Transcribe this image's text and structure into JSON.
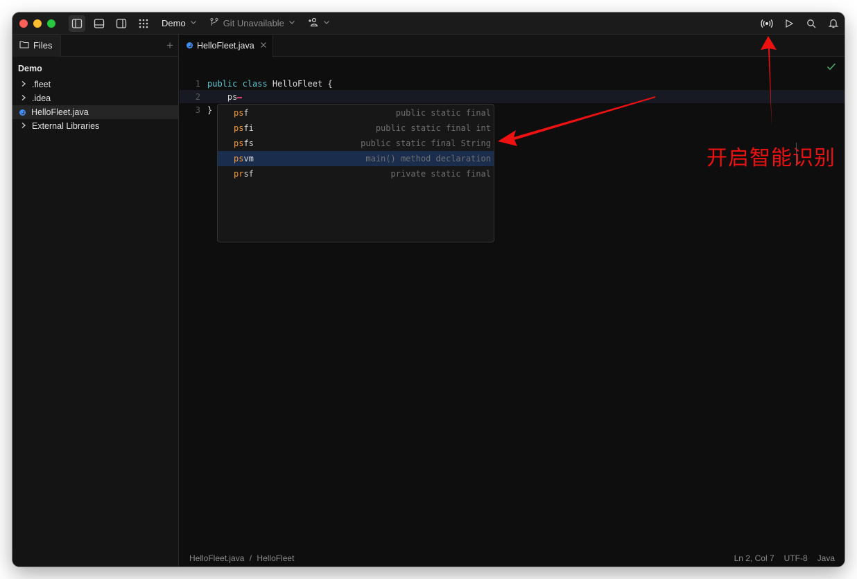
{
  "titlebar": {
    "project_label": "Demo",
    "git_label": "Git Unavailable"
  },
  "sidebar": {
    "tab_label": "Files",
    "project_title": "Demo",
    "items": [
      {
        "label": ".fleet",
        "type": "folder"
      },
      {
        "label": ".idea",
        "type": "folder"
      },
      {
        "label": "HelloFleet.java",
        "type": "java-file",
        "selected": true
      },
      {
        "label": "External Libraries",
        "type": "folder"
      }
    ]
  },
  "editor": {
    "tab_label": "HelloFleet.java",
    "lines": [
      {
        "number": "1",
        "keywords": "public class",
        "text": " HelloFleet {"
      },
      {
        "number": "2",
        "text": "    ps"
      },
      {
        "number": "3",
        "text": "}"
      }
    ]
  },
  "completion": {
    "items": [
      {
        "match": "ps",
        "rest": "f",
        "desc": "public static final"
      },
      {
        "match": "ps",
        "rest": "fi",
        "desc": "public static final int"
      },
      {
        "match": "ps",
        "rest": "fs",
        "desc": "public static final String"
      },
      {
        "match": "ps",
        "rest": "vm",
        "desc": "main() method declaration",
        "selected": true
      },
      {
        "match": "pr",
        "rest": "sf",
        "desc": "private static final"
      }
    ]
  },
  "statusbar": {
    "breadcrumb_file": "HelloFleet.java",
    "breadcrumb_sep": "/",
    "breadcrumb_class": "HelloFleet",
    "position": "Ln 2, Col 7",
    "encoding": "UTF-8",
    "language": "Java"
  },
  "annotation": {
    "text": "开启智能识别",
    "color": "#ee1111"
  },
  "colors": {
    "accent_blue": "#3d8ff5",
    "completion_match": "#f39a3b",
    "keyword": "#5fc6d0",
    "selection": "#1b2d4d"
  }
}
